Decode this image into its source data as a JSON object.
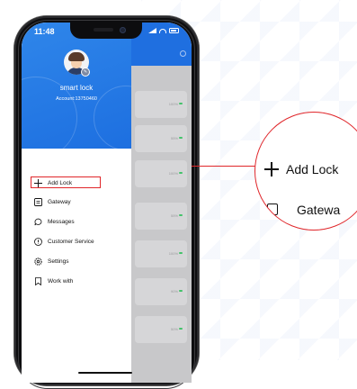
{
  "status_bar": {
    "time": "11:48"
  },
  "drawer": {
    "username": "smart lock",
    "account": "Account:13750460",
    "menu": [
      {
        "label": "Add Lock",
        "icon": "plus-icon"
      },
      {
        "label": "Gateway",
        "icon": "gateway-icon"
      },
      {
        "label": "Messages",
        "icon": "message-icon"
      },
      {
        "label": "Customer Service",
        "icon": "info-icon"
      },
      {
        "label": "Settings",
        "icon": "gear-icon"
      },
      {
        "label": "Work with",
        "icon": "bookmark-icon"
      }
    ]
  },
  "background_list": {
    "cards": [
      {
        "battery": "100%"
      },
      {
        "battery": "55%"
      },
      {
        "battery": "100%"
      },
      {
        "battery": "55%"
      },
      {
        "battery": "100%"
      },
      {
        "battery": "90%"
      },
      {
        "battery": "50%"
      }
    ]
  },
  "zoom_callout": {
    "label": "Add Lock",
    "partial_label": "Gatewa"
  },
  "colors": {
    "header_blue": "#1f6fe0",
    "highlight_red": "#e0262a",
    "battery_green": "#43c26a"
  }
}
